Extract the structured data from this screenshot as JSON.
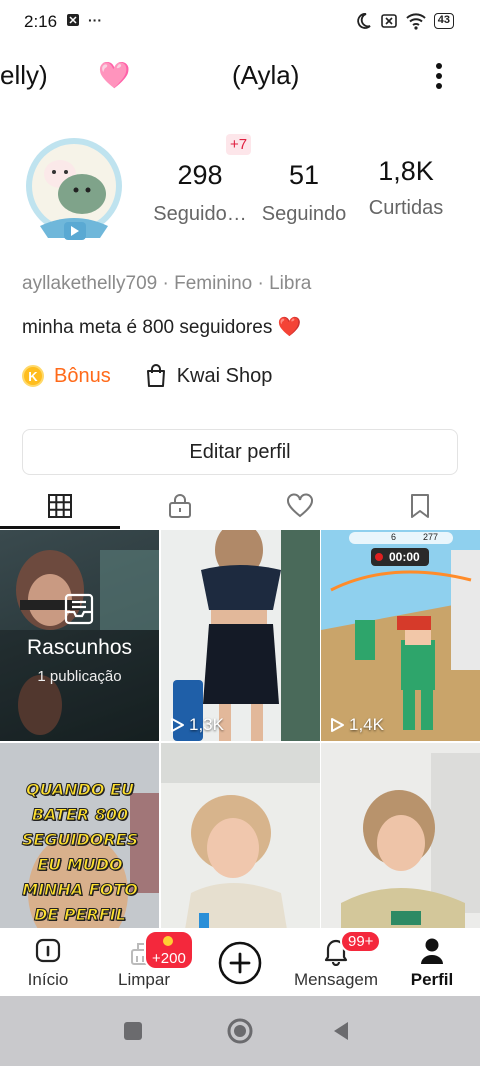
{
  "status_bar": {
    "time": "2:16",
    "more": "···",
    "battery": "43"
  },
  "header": {
    "left_name": "elly)",
    "title": "(Ayla)"
  },
  "stats": {
    "new_badge": "+7",
    "followers_count": "298",
    "followers_label": "Seguido…",
    "following_count": "51",
    "following_label": "Seguindo",
    "likes_count": "1,8K",
    "likes_label": "Curtidas"
  },
  "profile": {
    "meta": "ayllakethelly709 · Feminino · Libra",
    "bio": "minha meta é 800 seguidores ❤️"
  },
  "links": {
    "bonus_icon": "K",
    "bonus_label": "Bônus",
    "shop_label": "Kwai Shop"
  },
  "edit_button": "Editar perfil",
  "tabs": [
    "grid-icon",
    "lock-icon",
    "heart-icon",
    "bookmark-icon"
  ],
  "grid": {
    "drafts_title": "Rascunhos",
    "drafts_sub": "1 publicação",
    "video_1_views": "1,3K",
    "video_2_views": "1,4K",
    "video_3_caption": "QUANDO EU BATER 800 SEGUIDORES EU MUDO MINHA FOTO DE PERFIL",
    "game_score": "6",
    "game_time": "00:00",
    "game_num": "277"
  },
  "bottom_nav": {
    "home_label": "Início",
    "clean_label": "Limpar",
    "clean_badge": "+200",
    "messages_label": "Mensagem",
    "messages_badge": "99+",
    "profile_label": "Perfil"
  },
  "colors": {
    "accent_orange": "#ff6a1a",
    "badge_red": "#f4283c",
    "coin_yellow": "#ffbd1e"
  }
}
